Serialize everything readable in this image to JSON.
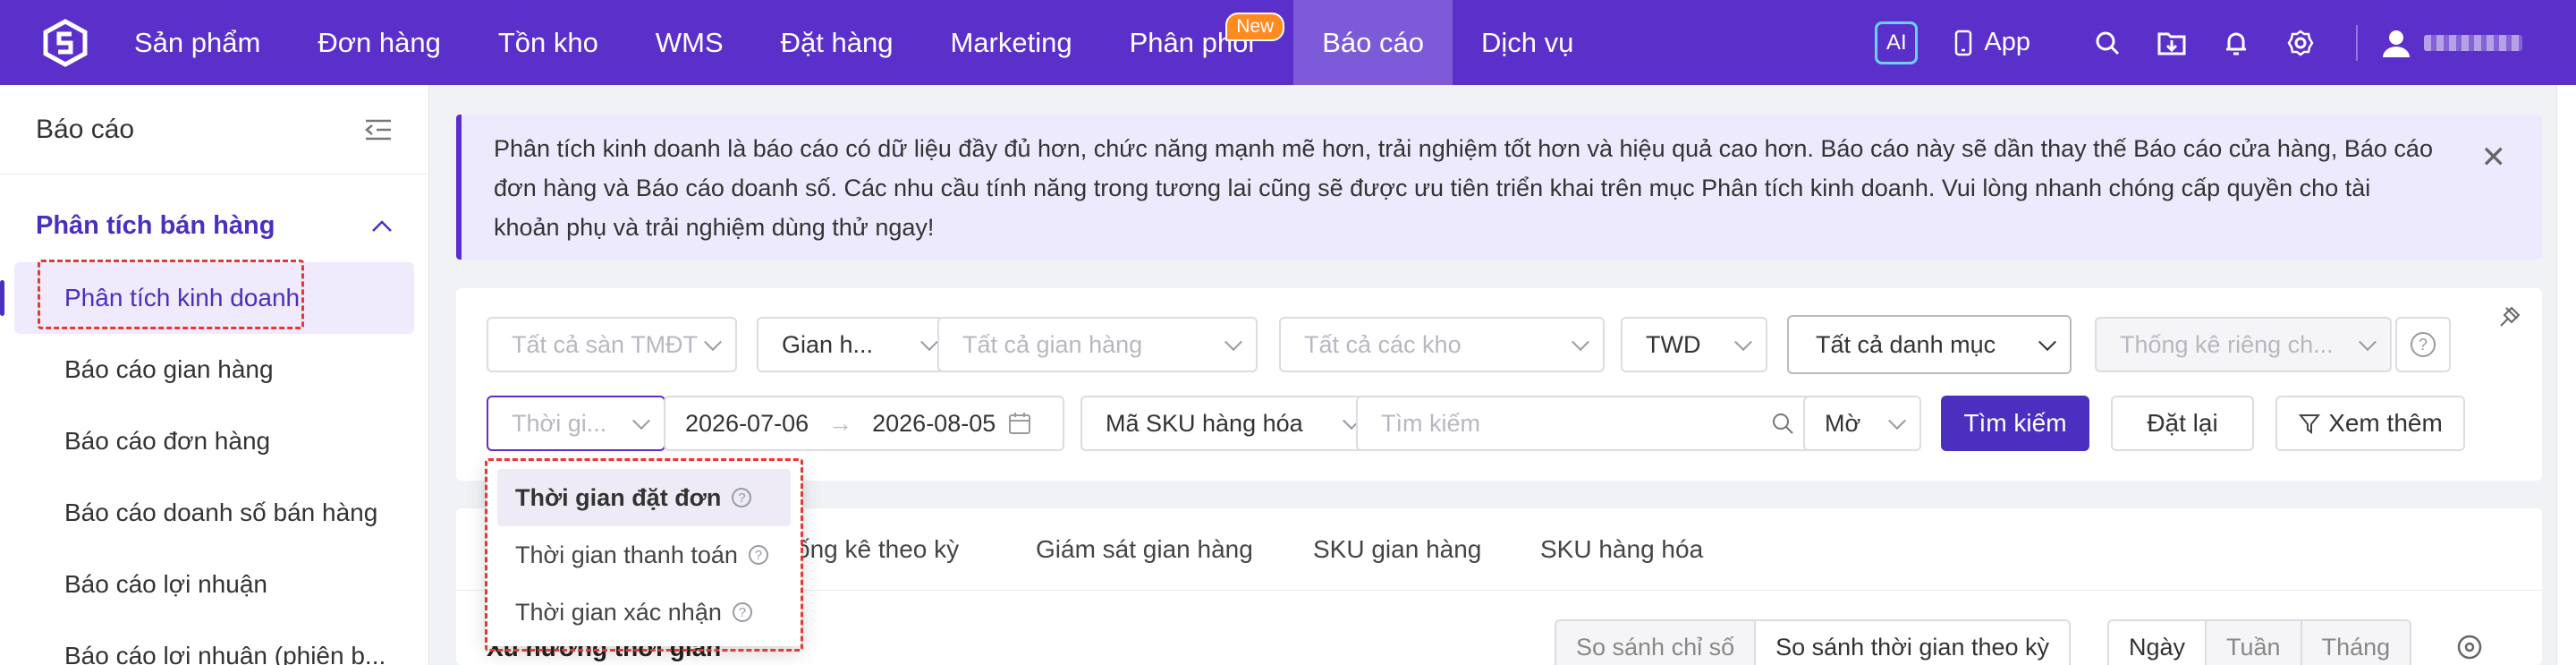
{
  "topbar": {
    "nav": [
      {
        "label": "Sản phẩm"
      },
      {
        "label": "Đơn hàng"
      },
      {
        "label": "Tồn kho"
      },
      {
        "label": "WMS"
      },
      {
        "label": "Đặt hàng"
      },
      {
        "label": "Marketing"
      },
      {
        "label": "Phân phối",
        "badge": "New"
      },
      {
        "label": "Báo cáo",
        "active": true
      },
      {
        "label": "Dịch vụ"
      }
    ],
    "ai_label": "AI",
    "app_label": "App",
    "colors": {
      "bar": "#5b2fc9",
      "active": "#7d5bd8",
      "badge": "#ff8a1f"
    }
  },
  "sidebar": {
    "title": "Báo cáo",
    "group_label": "Phân tích bán hàng",
    "items": [
      {
        "label": "Phân tích kinh doanh",
        "active": true
      },
      {
        "label": "Báo cáo gian hàng"
      },
      {
        "label": "Báo cáo đơn hàng"
      },
      {
        "label": "Báo cáo doanh số bán hàng"
      },
      {
        "label": "Báo cáo lợi nhuận"
      },
      {
        "label": "Báo cáo lợi nhuận (phiên b..."
      }
    ]
  },
  "banner": {
    "text": "Phân tích kinh doanh là báo cáo có dữ liệu đầy đủ hơn, chức năng mạnh mẽ hơn, trải nghiệm tốt hơn và hiệu quả cao hơn. Báo cáo này sẽ dần thay thế Báo cáo cửa hàng, Báo cáo đơn hàng và Báo cáo doanh số. Các nhu cầu tính năng trong tương lai cũng sẽ được ưu tiên triển khai trên mục Phân tích kinh doanh. Vui lòng nhanh chóng cấp quyền cho tài khoản phụ và trải nghiệm dùng thử ngay!"
  },
  "filters": {
    "platform_placeholder": "Tất cả sàn TMĐT",
    "store_type": "Gian h...",
    "store_placeholder": "Tất cả gian hàng",
    "warehouse_placeholder": "Tất cả các kho",
    "currency": "TWD",
    "category": "Tất cả danh mục",
    "stat_placeholder": "Thống kê riêng ch...",
    "time_placeholder": "Thời gi...",
    "date_start": "2026-07-06",
    "date_sep": "→",
    "date_end": "2026-08-05",
    "sku_type": "Mã SKU hàng hóa",
    "search_placeholder": "Tìm kiếm",
    "match_mode": "Mờ",
    "search_button": "Tìm kiếm",
    "reset_button": "Đặt lại",
    "more_button": "Xem thêm"
  },
  "time_dropdown": {
    "options": [
      {
        "label": "Thời gian đặt đơn",
        "selected": true
      },
      {
        "label": "Thời gian thanh toán"
      },
      {
        "label": "Thời gian xác nhận"
      }
    ]
  },
  "tabs": [
    {
      "label": "ống kê theo kỳ"
    },
    {
      "label": "Giám sát gian hàng"
    },
    {
      "label": "SKU gian hàng"
    },
    {
      "label": "SKU hàng hóa"
    }
  ],
  "section": {
    "title": "Xu hướng thời gian",
    "compare": [
      {
        "label": "So sánh chỉ số"
      },
      {
        "label": "So sánh thời gian theo kỳ",
        "on": true
      }
    ],
    "granularity": [
      {
        "label": "Ngày",
        "on": true
      },
      {
        "label": "Tuần"
      },
      {
        "label": "Tháng"
      }
    ]
  }
}
